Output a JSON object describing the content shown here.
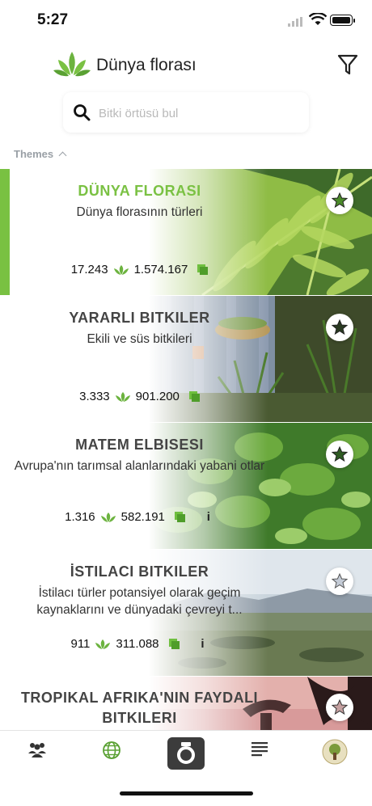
{
  "status_bar": {
    "time": "5:27"
  },
  "header": {
    "title": "Dünya florası"
  },
  "search": {
    "placeholder": "Bitki örtüsü bul"
  },
  "section": {
    "label": "Themes"
  },
  "colors": {
    "accent": "#79c142",
    "text": "#444444"
  },
  "cards": [
    {
      "title": "DÜNYA FLORASI",
      "description": "Dünya florasının türleri",
      "species_count": "17.243",
      "photo_count": "1.574.167",
      "active": true,
      "favorited": true
    },
    {
      "title": "YARARLI BITKILER",
      "description": "Ekili ve süs bitkileri",
      "species_count": "3.333",
      "photo_count": "901.200",
      "active": false,
      "favorited": true
    },
    {
      "title": "MATEM ELBISESI",
      "description": "Avrupa'nın tarımsal alanlarındaki yabani otlar",
      "species_count": "1.316",
      "photo_count": "582.191",
      "info": "i",
      "favorited": true
    },
    {
      "title": "İSTILACI BITKILER",
      "description": "İstilacı türler potansiyel olarak geçim kaynaklarını ve dünyadaki çevreyi t...",
      "species_count": "911",
      "photo_count": "311.088",
      "info": "i",
      "favorited": false
    },
    {
      "title": "TROPIKAL AFRIKA'NIN FAYDALI BITKILERI",
      "favorited": false
    }
  ],
  "tabs": [
    {
      "name": "community-icon"
    },
    {
      "name": "globe-icon",
      "active": true
    },
    {
      "name": "camera-icon"
    },
    {
      "name": "list-icon"
    },
    {
      "name": "profile-avatar"
    }
  ]
}
